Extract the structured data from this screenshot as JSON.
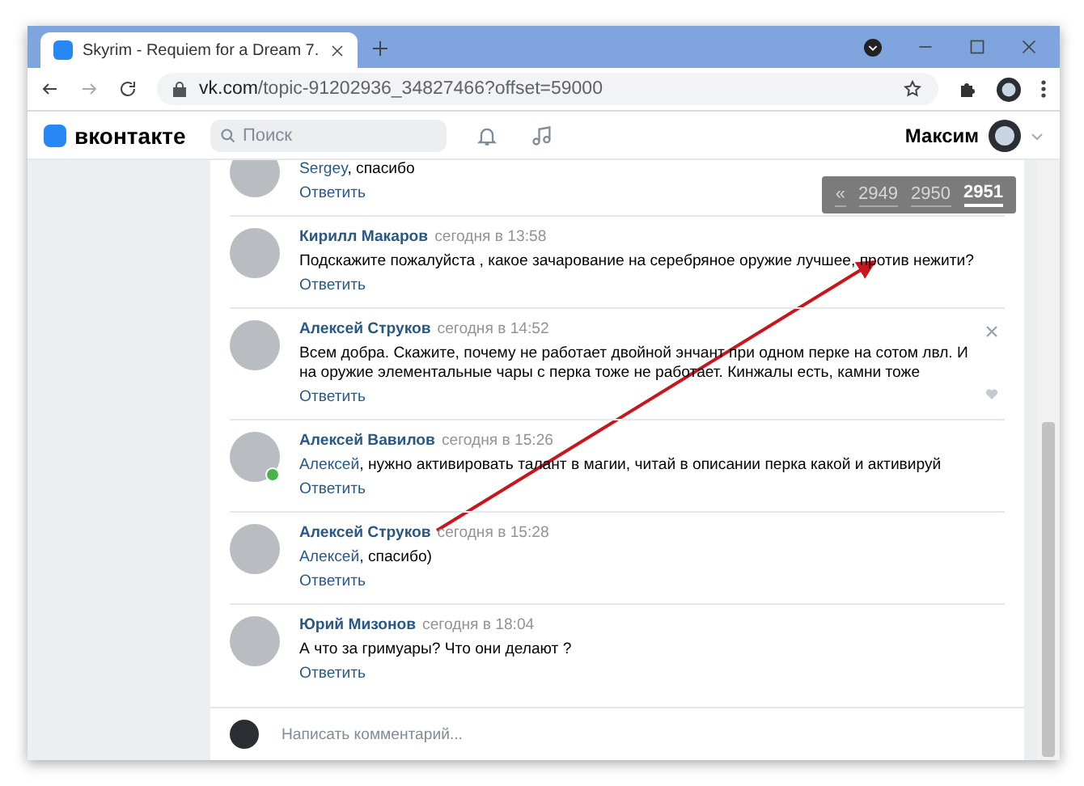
{
  "browser": {
    "tab_title": "Skyrim - Requiem for a Dream 7.",
    "url_host": "vk.com",
    "url_path": "/topic-91202936_34827466?offset=59000"
  },
  "header": {
    "logo": "вконтакте",
    "search": {
      "placeholder": "Поиск"
    },
    "user_name": "Максим"
  },
  "pagination": [
    {
      "label": "«",
      "selected": false
    },
    {
      "label": "2949",
      "selected": false
    },
    {
      "label": "2950",
      "selected": false
    },
    {
      "label": "2951",
      "selected": true
    }
  ],
  "comments": [
    {
      "mention": "Sergey",
      "text": ", спасибо",
      "reply": "Ответить",
      "online": false,
      "hovered": false
    },
    {
      "author": "Кирилл Макаров",
      "time": "сегодня в 13:58",
      "text": "Подскажите пожалуйста , какое зачарование на серебряное оружие лучшее, против нежити?",
      "reply": "Ответить",
      "online": false,
      "hovered": false
    },
    {
      "author": "Алексей Струков",
      "time": "сегодня в 14:52",
      "text": "Всем добра. Скажите, почему не работает двойной энчант при одном перке на сотом лвл. И на оружие элементальные чары с перка тоже не работает. Кинжалы есть, камни тоже",
      "reply": "Ответить",
      "online": false,
      "hovered": true
    },
    {
      "author": "Алексей Вавилов",
      "time": "сегодня в 15:26",
      "mention": "Алексей",
      "text": ", нужно активировать талант в магии, читай в описании перка какой и активируй",
      "reply": "Ответить",
      "online": true,
      "hovered": false
    },
    {
      "author": "Алексей Струков",
      "time": "сегодня в 15:28",
      "mention": "Алексей",
      "text": ", спасибо)",
      "reply": "Ответить",
      "online": false,
      "hovered": false
    },
    {
      "author": "Юрий Мизонов",
      "time": "сегодня в 18:04",
      "text": "А что за гримуары? Что они делают ?",
      "reply": "Ответить",
      "online": false,
      "hovered": false
    }
  ],
  "composer": {
    "placeholder": "Написать комментарий..."
  }
}
